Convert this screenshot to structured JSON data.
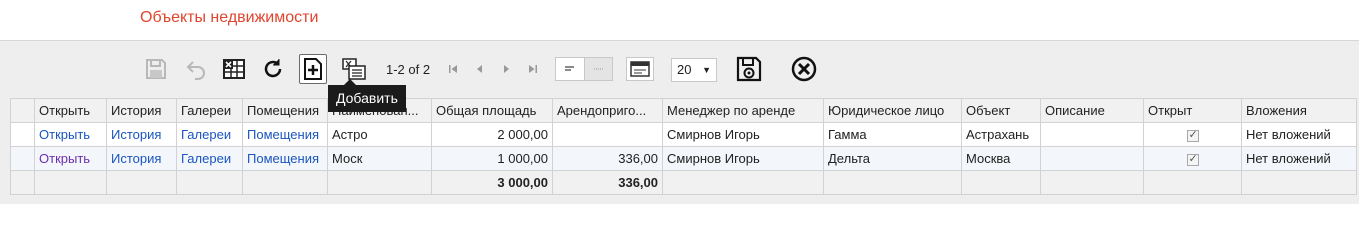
{
  "header": {
    "title": "Объекты недвижимости"
  },
  "toolbar": {
    "page_info": "1-2 of 2",
    "page_size": "20",
    "tooltip": "Добавить",
    "icons": {
      "save": "save-icon",
      "undo": "undo-icon",
      "excel": "excel-icon",
      "refresh": "refresh-icon",
      "add": "add-icon",
      "export": "export-icon",
      "first": "first-page-icon",
      "prev": "prev-page-icon",
      "next": "next-page-icon",
      "last": "last-page-icon",
      "grid_view": "list-view-icon",
      "details_view": "details-view-icon",
      "layout": "layout-icon",
      "save_settings": "save-settings-icon",
      "close": "close-icon"
    }
  },
  "table": {
    "columns": [
      "Открыть",
      "История",
      "Галереи",
      "Помещения",
      "Наименован...",
      "Общая площадь",
      "Арендоприго...",
      "Менеджер по аренде",
      "Юридическое лицо",
      "Объект",
      "Описание",
      "Открыт",
      "Вложения"
    ],
    "rows": [
      [
        "Открыть",
        "История",
        "Галереи",
        "Помещения",
        "Астро",
        "2 000,00",
        "",
        "Смирнов Игорь",
        "Гамма",
        "Астрахань",
        "",
        "✓",
        "Нет вложений"
      ],
      [
        "Открыть",
        "История",
        "Галереи",
        "Помещения",
        "Моск",
        "1 000,00",
        "336,00",
        "Смирнов Игорь",
        "Дельта",
        "Москва",
        "",
        "✓",
        "Нет вложений"
      ]
    ],
    "totals": {
      "area": "3 000,00",
      "rentable": "336,00"
    }
  },
  "colors": {
    "title": "#e0452e",
    "link": "#1a55c0",
    "visited_link": "#6b2fb0"
  }
}
